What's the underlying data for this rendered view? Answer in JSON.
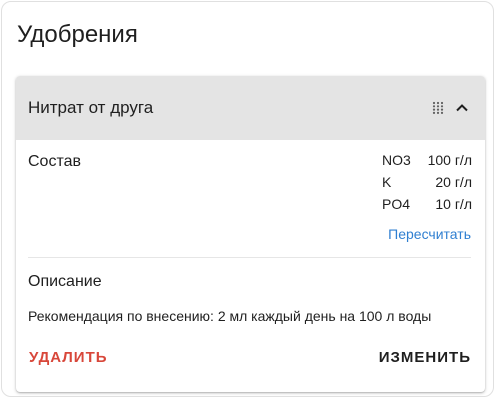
{
  "page": {
    "title": "Удобрения"
  },
  "fertilizer": {
    "name": "Нитрат от друга",
    "composition_label": "Состав",
    "nutrients": [
      {
        "name": "NO3",
        "value": "100 г/л"
      },
      {
        "name": "K",
        "value": "20 г/л"
      },
      {
        "name": "PO4",
        "value": "10 г/л"
      }
    ],
    "recalculate_label": "Пересчитать",
    "description_label": "Описание",
    "description": "Рекомендация по внесению: 2 мл каждый день на 100 л воды",
    "delete_label": "УДАЛИТЬ",
    "edit_label": "ИЗМЕНИТЬ"
  },
  "icons": {
    "drag": "drag-handle-icon",
    "collapse": "chevron-up-icon"
  },
  "colors": {
    "header_bg": "#e4e4e4",
    "link": "#2f7fd1",
    "danger": "#d8473a"
  }
}
